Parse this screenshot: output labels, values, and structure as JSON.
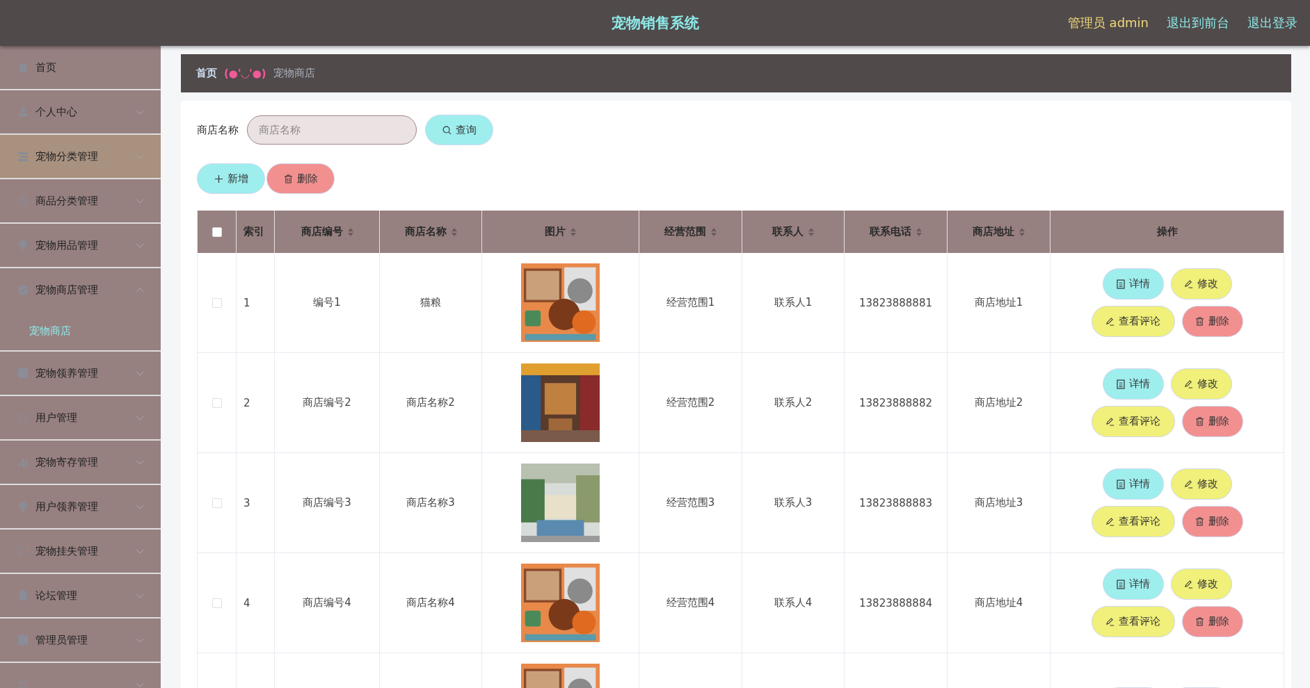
{
  "header": {
    "title": "宠物销售系统",
    "user": "管理员 admin",
    "links": [
      "退出到前台",
      "退出登录"
    ]
  },
  "sidebar": {
    "items": [
      {
        "label": "首页",
        "selected": false
      },
      {
        "label": "个人中心",
        "selected": false,
        "expanded": false
      },
      {
        "label": "宠物分类管理",
        "selected": true,
        "expanded": false
      },
      {
        "label": "商品分类管理",
        "selected": false,
        "expanded": false
      },
      {
        "label": "宠物用品管理",
        "selected": false,
        "expanded": false
      },
      {
        "label": "宠物商店管理",
        "selected": false,
        "expanded": true,
        "children": [
          {
            "label": "宠物商店",
            "selected": true
          }
        ]
      },
      {
        "label": "宠物领养管理",
        "selected": false,
        "expanded": false
      },
      {
        "label": "用户管理",
        "selected": false,
        "expanded": false
      },
      {
        "label": "宠物寄存管理",
        "selected": false,
        "expanded": false
      },
      {
        "label": "用户领养管理",
        "selected": false,
        "expanded": false
      },
      {
        "label": "宠物挂失管理",
        "selected": false,
        "expanded": false
      },
      {
        "label": "论坛管理",
        "selected": false,
        "expanded": false
      },
      {
        "label": "管理员管理",
        "selected": false,
        "expanded": false
      },
      {
        "selected": false,
        "expanded": false
      }
    ]
  },
  "breadcrumb": {
    "home": "首页",
    "emoticon": "(●'◡'●)",
    "current": "宠物商店"
  },
  "search": {
    "label": "商店名称",
    "placeholder": "商店名称",
    "button": "查询"
  },
  "toolbar": [
    {
      "kind": "add",
      "label": "新增"
    },
    {
      "kind": "delete",
      "label": "删除"
    }
  ],
  "table": {
    "select_all": {
      "checked": false
    },
    "columns": [
      {
        "label": "索引",
        "sortable": false
      },
      {
        "label": "商店编号",
        "sortable": true
      },
      {
        "label": "商店名称",
        "sortable": true
      },
      {
        "label": "图片",
        "sortable": true
      },
      {
        "label": "经营范围",
        "sortable": true
      },
      {
        "label": "联系人",
        "sortable": true
      },
      {
        "label": "联系电话",
        "sortable": true
      },
      {
        "label": "商店地址",
        "sortable": true
      },
      {
        "label": "操作",
        "sortable": false
      }
    ],
    "rows": [
      {
        "checked": false,
        "cells": [
          "1",
          "编号1",
          "猫粮",
          null,
          "经营范围1",
          "联系人1",
          "13823888881",
          "商店地址1"
        ],
        "actions": [
          {
            "kind": "detail",
            "label": "详情"
          },
          {
            "kind": "edit",
            "label": "修改"
          },
          {
            "kind": "comments",
            "label": "查看评论"
          },
          {
            "kind": "delete",
            "label": "删除"
          }
        ]
      },
      {
        "checked": false,
        "cells": [
          "2",
          "商店编号2",
          "商店名称2",
          null,
          "经营范围2",
          "联系人2",
          "13823888882",
          "商店地址2"
        ],
        "actions": [
          {
            "kind": "detail",
            "label": "详情"
          },
          {
            "kind": "edit",
            "label": "修改"
          },
          {
            "kind": "comments",
            "label": "查看评论"
          },
          {
            "kind": "delete",
            "label": "删除"
          }
        ]
      },
      {
        "checked": false,
        "cells": [
          "3",
          "商店编号3",
          "商店名称3",
          null,
          "经营范围3",
          "联系人3",
          "13823888883",
          "商店地址3"
        ],
        "actions": [
          {
            "kind": "detail",
            "label": "详情"
          },
          {
            "kind": "edit",
            "label": "修改"
          },
          {
            "kind": "comments",
            "label": "查看评论"
          },
          {
            "kind": "delete",
            "label": "删除"
          }
        ]
      },
      {
        "checked": false,
        "cells": [
          "4",
          "商店编号4",
          "商店名称4",
          null,
          "经营范围4",
          "联系人4",
          "13823888884",
          "商店地址4"
        ],
        "actions": [
          {
            "kind": "detail",
            "label": "详情"
          },
          {
            "kind": "edit",
            "label": "修改"
          },
          {
            "kind": "comments",
            "label": "查看评论"
          },
          {
            "kind": "delete",
            "label": "删除"
          }
        ]
      },
      {
        "cells": [
          null,
          null,
          null,
          null,
          null,
          null,
          null,
          null
        ],
        "actions": [
          {
            "kind": "detail"
          },
          {
            "kind": "edit"
          }
        ]
      }
    ]
  }
}
